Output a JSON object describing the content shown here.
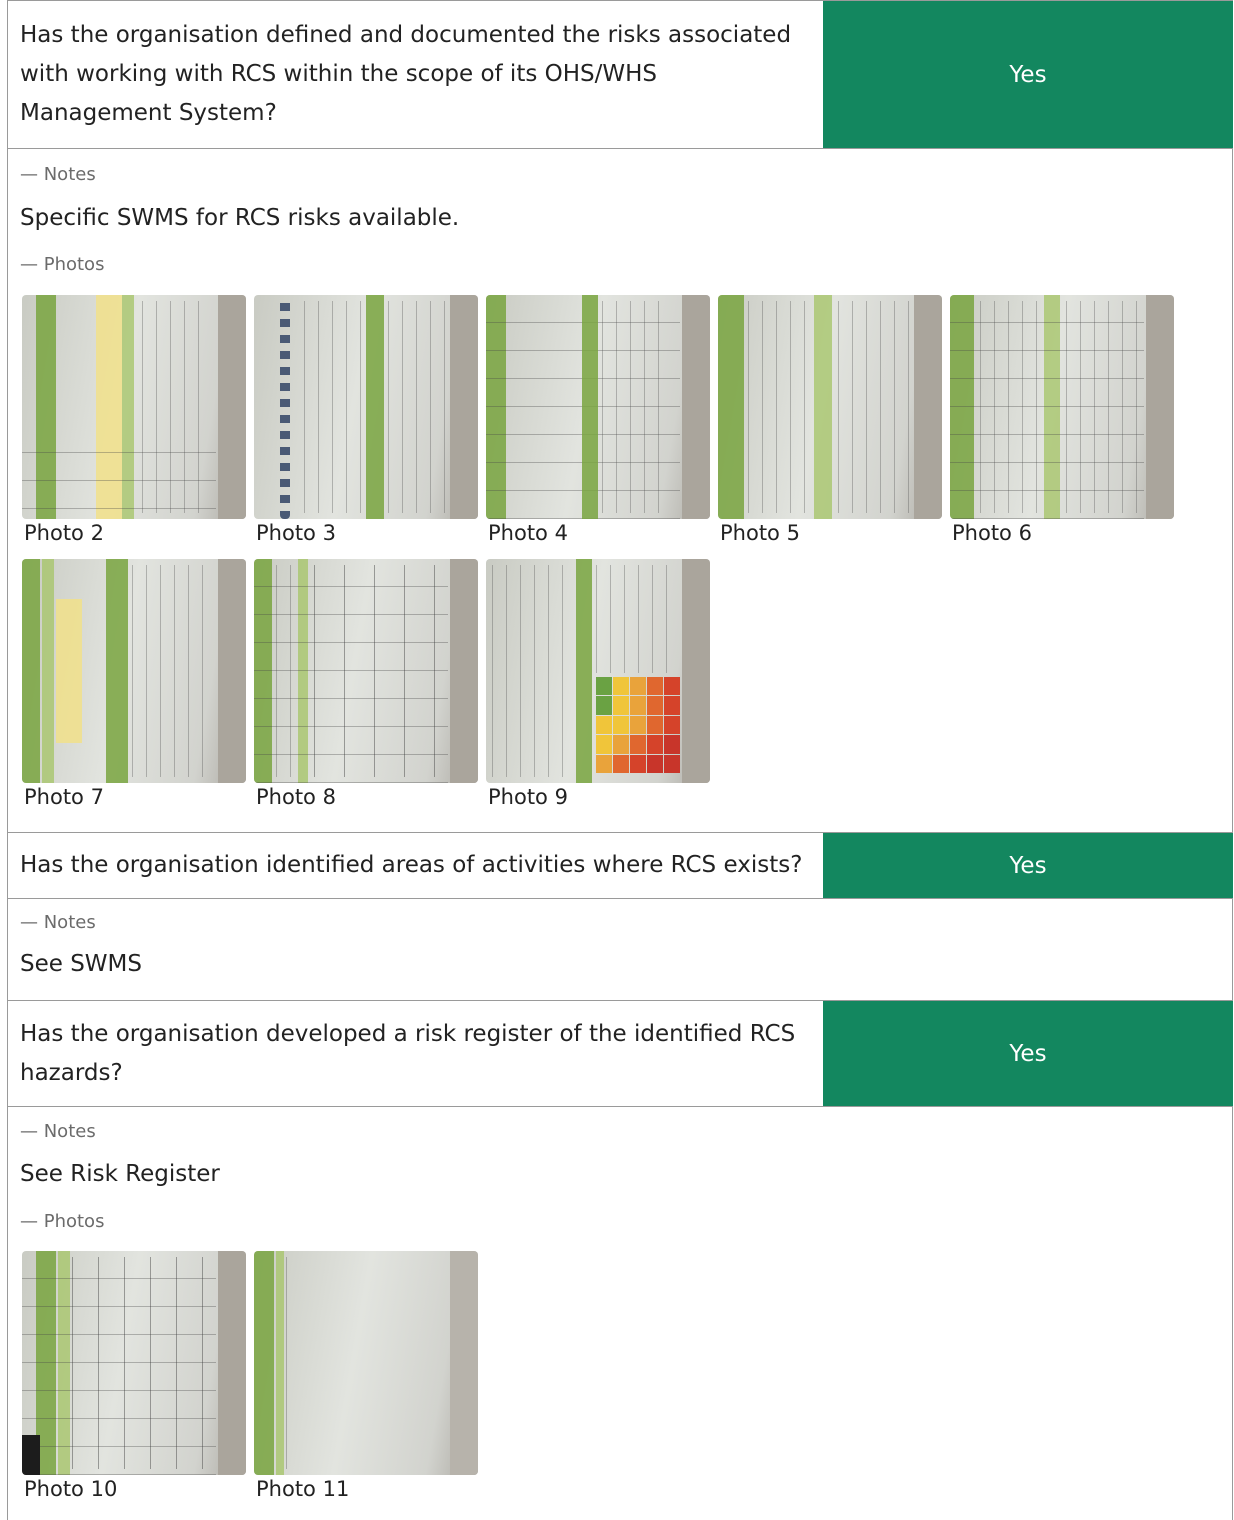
{
  "sections": [
    {
      "question": "Has the organisation defined and documented the risks associated with working with RCS within the scope of its OHS/WHS Management System?",
      "answer": "Yes",
      "notes_label": "— Notes",
      "notes": "Specific SWMS for RCS risks available.",
      "photos_label": "— Photos",
      "photos": [
        "Photo 2",
        "Photo 3",
        "Photo 4",
        "Photo 5",
        "Photo 6",
        "Photo 7",
        "Photo 8",
        "Photo 9"
      ]
    },
    {
      "question": "Has the organisation identified areas of activities where RCS exists?",
      "answer": "Yes",
      "notes_label": "— Notes",
      "notes": "See SWMS"
    },
    {
      "question": "Has the organisation developed a risk register of the identified RCS hazards?",
      "answer": "Yes",
      "notes_label": "— Notes",
      "notes": "See Risk Register",
      "photos_label": "— Photos",
      "photos": [
        "Photo 10",
        "Photo 11"
      ]
    }
  ],
  "colors": {
    "answer_yes": "#13875f",
    "border": "#9a9a9a",
    "document_green": "#79a43f"
  }
}
